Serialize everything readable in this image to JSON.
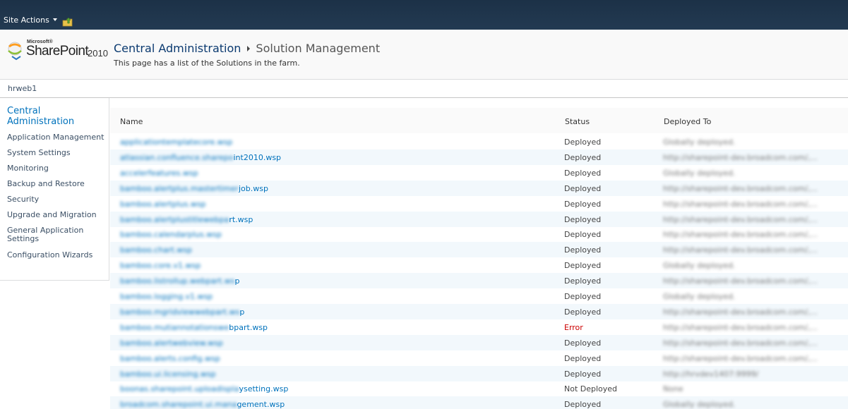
{
  "ribbon": {
    "site_actions_label": "Site Actions"
  },
  "header": {
    "logo": {
      "microsoft": "Microsoft®",
      "product": "SharePoint",
      "year": "2010"
    },
    "breadcrumb_root": "Central Administration",
    "breadcrumb_current": "Solution Management",
    "description": "This page has a list of the Solutions in the farm."
  },
  "topbar": {
    "tab_label": "hrweb1"
  },
  "sidebar": {
    "heading": "Central Administration",
    "items": [
      {
        "label": "Application Management"
      },
      {
        "label": "System Settings"
      },
      {
        "label": "Monitoring"
      },
      {
        "label": "Backup and Restore"
      },
      {
        "label": "Security"
      },
      {
        "label": "Upgrade and Migration"
      },
      {
        "label": "General Application Settings"
      },
      {
        "label": "Configuration Wizards"
      }
    ]
  },
  "table": {
    "columns": [
      "Name",
      "Status",
      "Deployed To"
    ],
    "rows": [
      {
        "name_hidden": "applicationtemplatecore.wsp",
        "name_visible": "",
        "status": "Deployed",
        "deployed_to": "Globally deployed."
      },
      {
        "name_hidden": "atlassian.confluence.sharepo",
        "name_visible": "int2010.wsp",
        "status": "Deployed",
        "deployed_to": "http://sharepoint-dev.broadcom.com/,..."
      },
      {
        "name_hidden": "accelerfeatures.wsp",
        "name_visible": "",
        "status": "Deployed",
        "deployed_to": "Globally deployed."
      },
      {
        "name_hidden": "bamboo.alertplus.mastertimer",
        "name_visible": "job.wsp",
        "status": "Deployed",
        "deployed_to": "http://sharepoint-dev.broadcom.com/,..."
      },
      {
        "name_hidden": "bamboo.alertplus.wsp",
        "name_visible": "",
        "status": "Deployed",
        "deployed_to": "http://sharepoint-dev.broadcom.com/,..."
      },
      {
        "name_hidden": "bamboo.alertplustitlewebpa",
        "name_visible": "rt.wsp",
        "status": "Deployed",
        "deployed_to": "http://sharepoint-dev.broadcom.com/,..."
      },
      {
        "name_hidden": "bamboo.calendarplus.wsp",
        "name_visible": "",
        "status": "Deployed",
        "deployed_to": "http://sharepoint-dev.broadcom.com/,..."
      },
      {
        "name_hidden": "bamboo.chart.wsp",
        "name_visible": "",
        "status": "Deployed",
        "deployed_to": "http://sharepoint-dev.broadcom.com/,..."
      },
      {
        "name_hidden": "bamboo.core.v1.wsp",
        "name_visible": "",
        "status": "Deployed",
        "deployed_to": "Globally deployed."
      },
      {
        "name_hidden": "bamboo.listrollup.webpart.ws",
        "name_visible": "p",
        "status": "Deployed",
        "deployed_to": "http://sharepoint-dev.broadcom.com/,..."
      },
      {
        "name_hidden": "bamboo.logging.v1.wsp",
        "name_visible": "",
        "status": "Deployed",
        "deployed_to": "Globally deployed."
      },
      {
        "name_hidden": "bamboo.mgridviewwebpart.ws",
        "name_visible": "p",
        "status": "Deployed",
        "deployed_to": "http://sharepoint-dev.broadcom.com/,..."
      },
      {
        "name_hidden": "bamboo.mutiannotationswe",
        "name_visible": "bpart.wsp",
        "status": "Error",
        "deployed_to": "http://sharepoint-dev.broadcom.com/,..."
      },
      {
        "name_hidden": "bamboo.alertwebview.wsp",
        "name_visible": "",
        "status": "Deployed",
        "deployed_to": "http://sharepoint-dev.broadcom.com/,..."
      },
      {
        "name_hidden": "bamboo.alerts.config.wsp",
        "name_visible": "",
        "status": "Deployed",
        "deployed_to": "http://sharepoint-dev.broadcom.com/,..."
      },
      {
        "name_hidden": "bamboo.ui.licensing.wsp",
        "name_visible": "",
        "status": "Deployed",
        "deployed_to": "http://hrvdev1407:9999/"
      },
      {
        "name_hidden": "boonas.sharepoint.uploadispla",
        "name_visible": "ysetting.wsp",
        "status": "Not Deployed",
        "deployed_to": "None"
      },
      {
        "name_hidden": "broadcom.sharepoint.ui.mana",
        "name_visible": "gement.wsp",
        "status": "Deployed",
        "deployed_to": "Globally deployed."
      }
    ]
  },
  "colors": {
    "ribbon_bg": "#1c3147",
    "link": "#0072bc",
    "error": "#cc0000",
    "row_alt": "#f2f8fc"
  }
}
